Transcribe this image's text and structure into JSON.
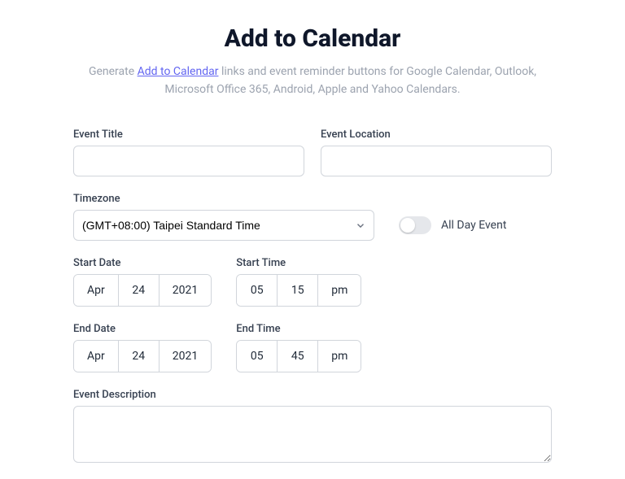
{
  "header": {
    "title": "Add to Calendar",
    "subtitle_pre": "Generate ",
    "subtitle_link": "Add to Calendar",
    "subtitle_post": " links and event reminder buttons for Google Calendar, Outlook, Microsoft Office 365, Android, Apple and Yahoo Calendars."
  },
  "labels": {
    "event_title": "Event Title",
    "event_location": "Event Location",
    "timezone": "Timezone",
    "all_day": "All Day Event",
    "start_date": "Start Date",
    "start_time": "Start Time",
    "end_date": "End Date",
    "end_time": "End Time",
    "description": "Event Description"
  },
  "values": {
    "event_title": "",
    "event_location": "",
    "timezone": "(GMT+08:00) Taipei Standard Time",
    "all_day": false,
    "start_date": {
      "month": "Apr",
      "day": "24",
      "year": "2021"
    },
    "start_time": {
      "hour": "05",
      "minute": "15",
      "ampm": "pm"
    },
    "end_date": {
      "month": "Apr",
      "day": "24",
      "year": "2021"
    },
    "end_time": {
      "hour": "05",
      "minute": "45",
      "ampm": "pm"
    },
    "description": ""
  }
}
